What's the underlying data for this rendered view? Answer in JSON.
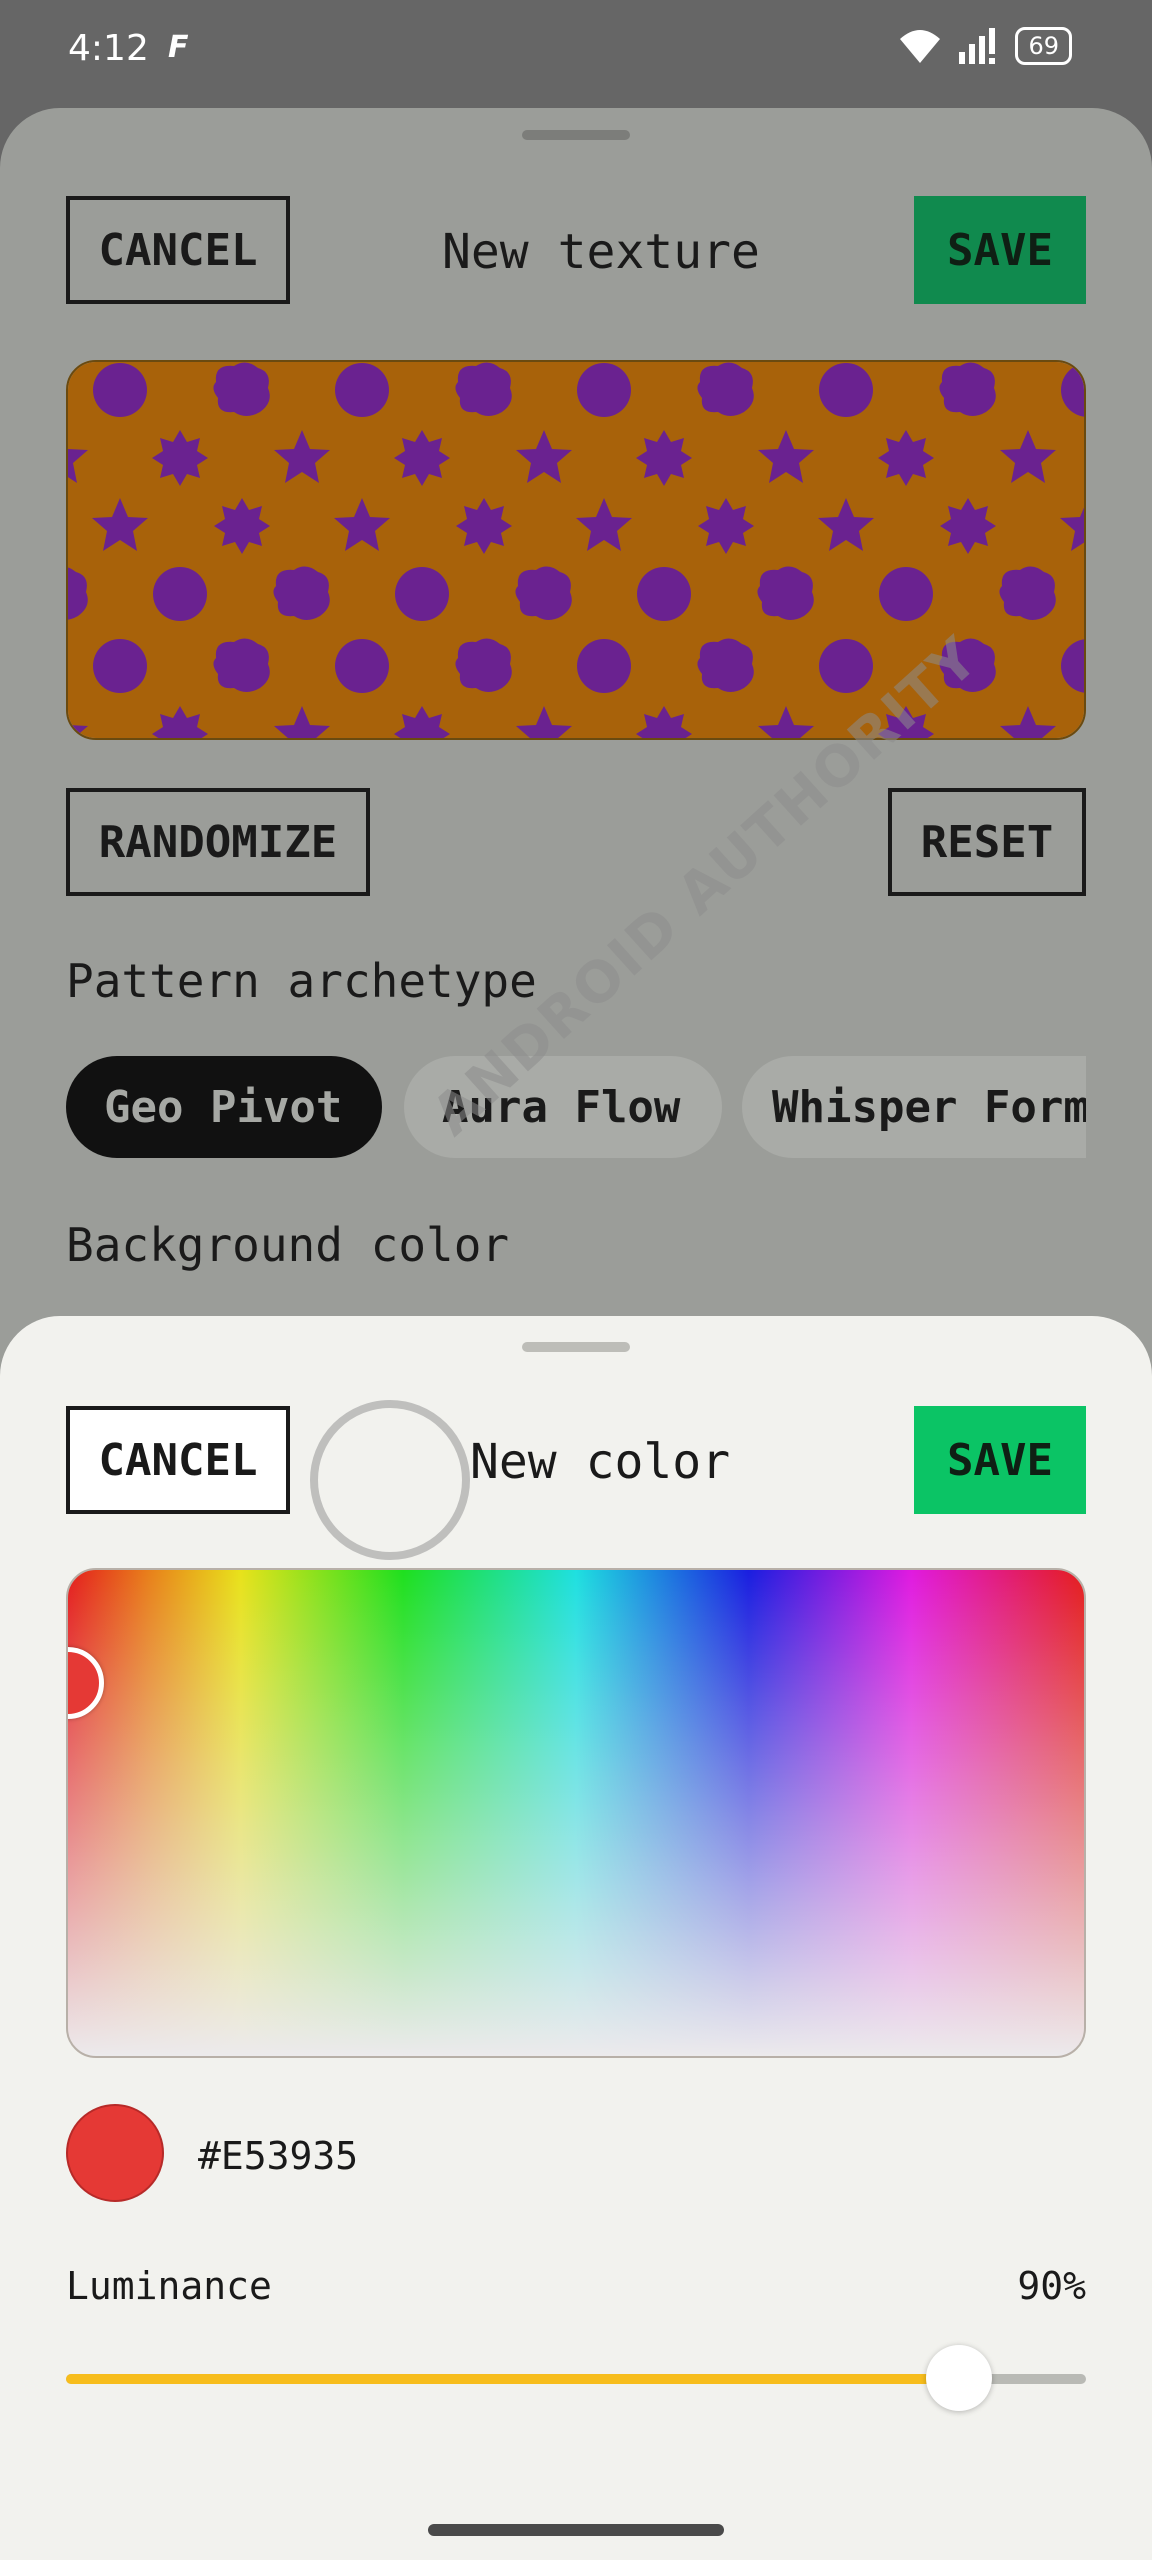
{
  "status_bar": {
    "time": "4:12",
    "app_icon": "F",
    "battery": "69",
    "icons": [
      "wifi-icon",
      "signal-icon",
      "battery-icon"
    ]
  },
  "texture_sheet": {
    "cancel_label": "CANCEL",
    "title": "New texture",
    "save_label": "SAVE",
    "randomize_label": "RANDOMIZE",
    "reset_label": "RESET",
    "pattern_label": "Pattern archetype",
    "chips": [
      {
        "label": "Geo Pivot",
        "selected": true
      },
      {
        "label": "Aura Flow",
        "selected": false
      },
      {
        "label": "Whisper Form",
        "selected": false
      }
    ],
    "background_label": "Background color",
    "texture_colors": {
      "background": "#a8620a",
      "shapes": "#6a2290"
    }
  },
  "color_sheet": {
    "cancel_label": "CANCEL",
    "title": "New color",
    "save_label": "SAVE",
    "hex_value": "#E53935",
    "luminance_label": "Luminance",
    "luminance_value": "90%",
    "luminance_fraction": 0.875,
    "save_color": "#0bc465"
  },
  "watermark": {
    "text": "ANDROID AUTHORITY"
  }
}
